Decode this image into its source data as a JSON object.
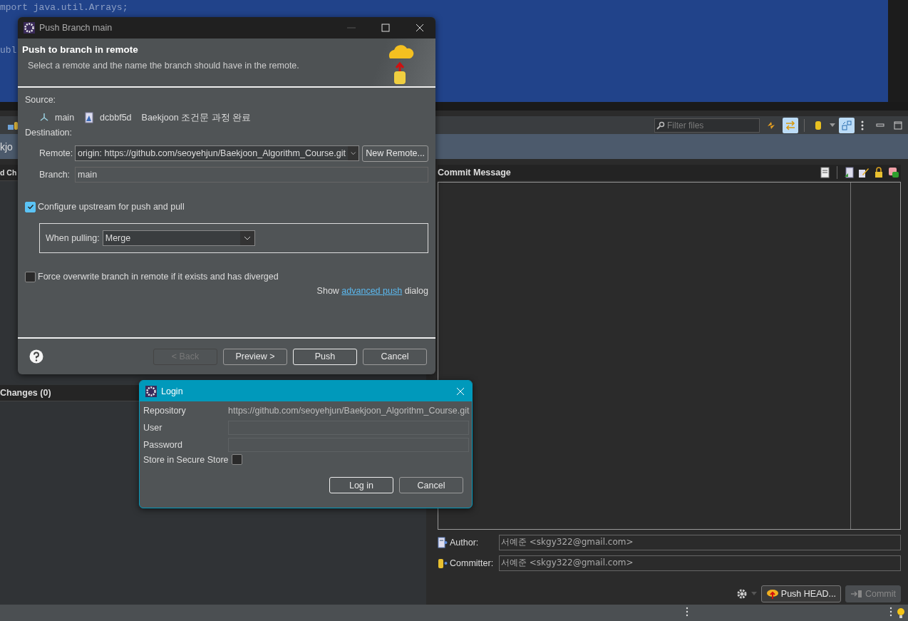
{
  "editor": {
    "code_lines": [
      "mport java.util.Arrays;",
      "ubl"
    ]
  },
  "staging": {
    "view_title": "kjo",
    "filter": {
      "placeholder": "Filter files"
    },
    "toolbar": [
      {
        "kind": "refresh",
        "selected": false
      },
      {
        "kind": "swap",
        "selected": true
      },
      {
        "kind": "repo",
        "selected": false
      },
      {
        "kind": "layout",
        "selected": true
      }
    ],
    "unstaged_header": "d Ch",
    "staged_header": "Changes (0)",
    "commit_message_title": "Commit Message",
    "author": {
      "label": "Author:",
      "value": "서예준 <skgy322@gmail.com>"
    },
    "committer": {
      "label": "Committer:",
      "value": "서예준 <skgy322@gmail.com>"
    },
    "push_head_button": "Push HEAD...",
    "commit_button": {
      "label": "Commit",
      "disabled": true
    }
  },
  "push_dialog": {
    "title": "Push Branch main",
    "heading": "Push to branch in remote",
    "description": "Select a remote and the name the branch should have in the remote.",
    "source_label": "Source:",
    "source_branch": "main",
    "source_commit_id": "dcbbf5d",
    "source_commit_message": "Baekjoon 조건문 과정 완료",
    "destination_label": "Destination:",
    "remote": {
      "label": "Remote:",
      "value": "origin: https://github.com/seoyehjun/Baekjoon_Algorithm_Course.git",
      "button": "New Remote..."
    },
    "branch": {
      "label": "Branch:",
      "value": "main"
    },
    "configure_upstream": {
      "label": "Configure upstream for push and pull",
      "checked": true
    },
    "when_pulling": {
      "label": "When pulling:",
      "value": "Merge"
    },
    "force_overwrite": {
      "label": "Force overwrite branch in remote if it exists and has diverged",
      "checked": false
    },
    "advanced": {
      "before": "Show",
      "link": "advanced push",
      "after": "dialog"
    },
    "buttons": [
      {
        "label": "< Back",
        "disabled": true,
        "default": false
      },
      {
        "label": "Preview >",
        "disabled": false,
        "default": false
      },
      {
        "label": "Push",
        "disabled": false,
        "default": true
      },
      {
        "label": "Cancel",
        "disabled": false,
        "default": false
      }
    ]
  },
  "login_dialog": {
    "title": "Login",
    "repository_label": "Repository",
    "repository_value": "https://github.com/seoyehjun/Baekjoon_Algorithm_Course.git",
    "user_label": "User",
    "password_label": "Password",
    "store": {
      "label": "Store in Secure Store",
      "checked": false
    },
    "buttons": [
      {
        "label": "Log in",
        "default": true
      },
      {
        "label": "Cancel",
        "default": false
      }
    ]
  }
}
